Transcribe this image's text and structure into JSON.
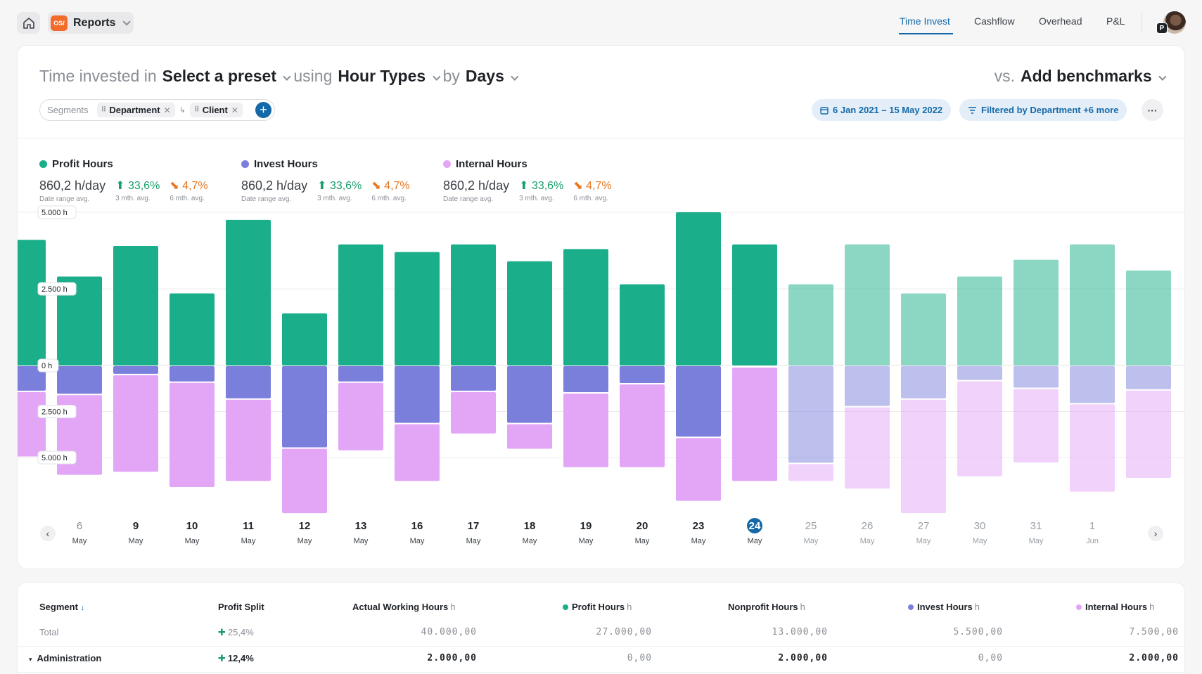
{
  "topbar": {
    "app_logo": "OS/",
    "app_name": "Reports",
    "nav": [
      "Time Invest",
      "Cashflow",
      "Overhead",
      "P&L"
    ],
    "avatar_badge": "P"
  },
  "query": {
    "prefix": "Time invested in",
    "preset": "Select a preset",
    "using": "using",
    "hour_types": "Hour Types",
    "by": "by",
    "period": "Days",
    "vs": "vs.",
    "benchmarks": "Add benchmarks"
  },
  "segments": {
    "label": "Segments",
    "chips": [
      "Department",
      "Client"
    ],
    "add": "+"
  },
  "filters": {
    "date_range": "6 Jan 2021 – 15 May 2022",
    "filter": "Filtered by Department +6 more",
    "more": "···"
  },
  "legend": [
    {
      "name": "Profit Hours",
      "color": "#1aae8a",
      "avg": "860,2 h/day",
      "avg_label": "Date range avg.",
      "m3": "33,6%",
      "m3_label": "3 mth. avg.",
      "m6": "4,7%",
      "m6_label": "6 mth. avg."
    },
    {
      "name": "Invest Hours",
      "color": "#7b7fdc",
      "avg": "860,2 h/day",
      "avg_label": "Date range avg.",
      "m3": "33,6%",
      "m3_label": "3 mth. avg.",
      "m6": "4,7%",
      "m6_label": "6 mth. avg."
    },
    {
      "name": "Internal Hours",
      "color": "#e3a6f7",
      "avg": "860,2 h/day",
      "avg_label": "Date range avg.",
      "m3": "33,6%",
      "m3_label": "3 mth. avg.",
      "m6": "4,7%",
      "m6_label": "6 mth. avg."
    }
  ],
  "chart_data": {
    "type": "bar",
    "y_tick_labels": [
      "5.000 h",
      "2.500 h",
      "0 h",
      "2.500 h",
      "5.000 h"
    ],
    "ylim": [
      -5000,
      5000
    ],
    "colors": {
      "profit": "#1aae8a",
      "invest": "#7b7fdc",
      "internal": "#e3a6f7"
    },
    "categories": [
      {
        "day": "",
        "month": "",
        "profit": 4100,
        "invest": 800,
        "internal": 2100,
        "future": false
      },
      {
        "day": "6",
        "month": "May",
        "profit": 2900,
        "invest": 900,
        "internal": 2600,
        "future": false
      },
      {
        "day": "9",
        "month": "May",
        "profit": 3900,
        "invest": 250,
        "internal": 3150,
        "future": false
      },
      {
        "day": "10",
        "month": "May",
        "profit": 2350,
        "invest": 500,
        "internal": 3400,
        "future": false
      },
      {
        "day": "11",
        "month": "May",
        "profit": 4750,
        "invest": 1050,
        "internal": 2650,
        "future": false
      },
      {
        "day": "12",
        "month": "May",
        "profit": 1700,
        "invest": 2650,
        "internal": 2100,
        "future": false
      },
      {
        "day": "13",
        "month": "May",
        "profit": 3950,
        "invest": 500,
        "internal": 2200,
        "future": false
      },
      {
        "day": "16",
        "month": "May",
        "profit": 3700,
        "invest": 1850,
        "internal": 1850,
        "future": false
      },
      {
        "day": "17",
        "month": "May",
        "profit": 3950,
        "invest": 800,
        "internal": 1350,
        "future": false
      },
      {
        "day": "18",
        "month": "May",
        "profit": 3400,
        "invest": 1850,
        "internal": 800,
        "future": false
      },
      {
        "day": "19",
        "month": "May",
        "profit": 3800,
        "invest": 850,
        "internal": 2400,
        "future": false
      },
      {
        "day": "20",
        "month": "May",
        "profit": 2650,
        "invest": 550,
        "internal": 2700,
        "future": false
      },
      {
        "day": "23",
        "month": "May",
        "profit": 5000,
        "invest": 2300,
        "internal": 2050,
        "future": false
      },
      {
        "day": "24",
        "month": "May",
        "profit": 3950,
        "invest": 0,
        "internal": 3700,
        "future": false,
        "today": true
      },
      {
        "day": "25",
        "month": "May",
        "profit": 2650,
        "invest": 3150,
        "internal": 550,
        "future": true
      },
      {
        "day": "26",
        "month": "May",
        "profit": 3950,
        "invest": 1300,
        "internal": 2650,
        "future": true
      },
      {
        "day": "27",
        "month": "May",
        "profit": 2350,
        "invest": 1050,
        "internal": 3700,
        "future": true
      },
      {
        "day": "30",
        "month": "May",
        "profit": 2900,
        "invest": 450,
        "internal": 3100,
        "future": true
      },
      {
        "day": "31",
        "month": "May",
        "profit": 3450,
        "invest": 700,
        "internal": 2400,
        "future": true
      },
      {
        "day": "1",
        "month": "Jun",
        "profit": 3950,
        "invest": 1200,
        "internal": 2850,
        "future": true
      },
      {
        "day": "",
        "month": "",
        "profit": 3100,
        "invest": 750,
        "internal": 2850,
        "future": true
      }
    ]
  },
  "table": {
    "headers": {
      "segment": "Segment",
      "profit_split": "Profit Split",
      "actual": "Actual Working Hours",
      "profit": "Profit Hours",
      "nonprofit": "Nonprofit Hours",
      "invest": "Invest Hours",
      "internal": "Internal Hours",
      "unit": "h"
    },
    "rows": [
      {
        "segment": "Total",
        "profit_split": "25,4%",
        "actual": "40.000,00",
        "profit": "27.000,00",
        "nonprofit": "13.000,00",
        "invest": "5.500,00",
        "internal": "7.500,00"
      },
      {
        "segment": "Administration",
        "profit_split": "12,4%",
        "actual": "2.000,00",
        "profit": "0,00",
        "nonprofit": "2.000,00",
        "invest": "0,00",
        "internal": "2.000,00"
      }
    ]
  }
}
